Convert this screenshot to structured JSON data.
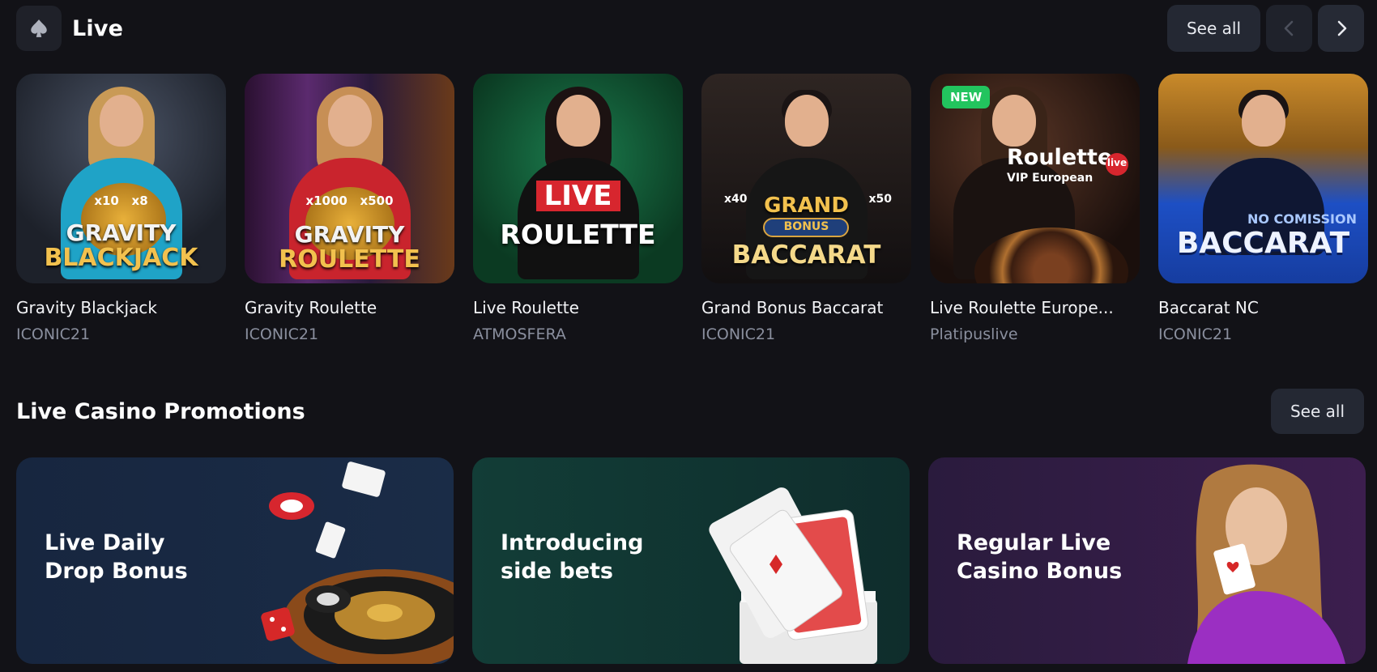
{
  "live": {
    "title": "Live",
    "icon": "spade-icon",
    "see_all": "See all",
    "prev_icon": "chevron-left-icon",
    "next_icon": "chevron-right-icon"
  },
  "games": [
    {
      "name": "Gravity Blackjack",
      "provider": "ICONIC21",
      "logo_line1": "GRAVITY",
      "logo_line2": "BLACKJACK",
      "multipliers": [
        "x10",
        "x8"
      ],
      "bg": "#2a2f3a",
      "accent": "#1fa3c7"
    },
    {
      "name": "Gravity Roulette",
      "provider": "ICONIC21",
      "logo_line1": "GRAVITY",
      "logo_line2": "ROULETTE",
      "multipliers": [
        "x1000",
        "x500"
      ],
      "bg": "#3a1f3e",
      "accent": "#c9242d"
    },
    {
      "name": "Live Roulette",
      "provider": "ATMOSFERA",
      "logo_line1": "LIVE",
      "logo_line2": "ROULETTE",
      "bg": "#0f5a35",
      "accent": "#111111"
    },
    {
      "name": "Grand Bonus Baccarat",
      "provider": "ICONIC21",
      "logo_line1": "GRAND",
      "logo_badge": "BONUS",
      "logo_line2": "BACCARAT",
      "multipliers": [
        "x40",
        "x50"
      ],
      "bg": "#1e1a1a",
      "accent": "#1a1a1a"
    },
    {
      "name": "Live Roulette Europe...",
      "provider": "Platipuslive",
      "badge": "NEW",
      "logo_line1": "Roulette",
      "logo_tag": "live",
      "logo_line2": "VIP European",
      "bg": "#2b1a14",
      "accent": "#1a1210"
    },
    {
      "name": "Baccarat NC",
      "provider": "ICONIC21",
      "logo_line1": "NO COMISSION",
      "logo_line2": "BACCARAT",
      "bg": "#1d4fc4",
      "accent": "#0f1733"
    }
  ],
  "promotions": {
    "title": "Live Casino Promotions",
    "see_all": "See all",
    "items": [
      {
        "title": "Live Daily\nDrop Bonus",
        "bg_from": "#1a2a44",
        "bg_to": "#16233a"
      },
      {
        "title": "Introducing\nside bets",
        "bg_from": "#123c36",
        "bg_to": "#112a2a"
      },
      {
        "title": "Regular Live\nCasino Bonus",
        "bg_from": "#2a1a3e",
        "bg_to": "#3a1d4c"
      }
    ]
  }
}
